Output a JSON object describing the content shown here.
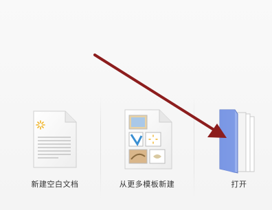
{
  "actions": {
    "new_blank": {
      "label": "新建空白文档",
      "icon": "blank-document-icon"
    },
    "new_from_template": {
      "label": "从更多模板新建",
      "icon": "template-document-icon"
    },
    "open": {
      "label": "打开",
      "icon": "folder-icon"
    }
  },
  "colors": {
    "annotation_arrow": "#8c1d1d",
    "folder_blue": "#7f9be6",
    "background": "#f6f6f6"
  }
}
